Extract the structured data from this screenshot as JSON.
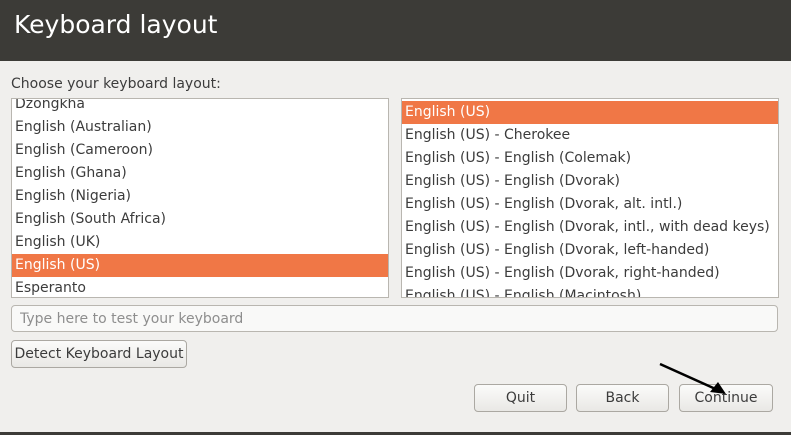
{
  "window": {
    "title": "Keyboard layout"
  },
  "prompt": "Choose your keyboard layout:",
  "layouts": {
    "items": [
      "Dzongkha",
      "English (Australian)",
      "English (Cameroon)",
      "English (Ghana)",
      "English (Nigeria)",
      "English (South Africa)",
      "English (UK)",
      "English (US)",
      "Esperanto"
    ],
    "selected": "English (US)"
  },
  "variants": {
    "items": [
      "English (US)",
      "English (US) - Cherokee",
      "English (US) - English (Colemak)",
      "English (US) - English (Dvorak)",
      "English (US) - English (Dvorak, alt. intl.)",
      "English (US) - English (Dvorak, intl., with dead keys)",
      "English (US) - English (Dvorak, left-handed)",
      "English (US) - English (Dvorak, right-handed)",
      "English (US) - English (Macintosh)"
    ],
    "selected": "English (US)"
  },
  "test_input": {
    "placeholder": "Type here to test your keyboard",
    "value": ""
  },
  "buttons": {
    "detect": "Detect Keyboard Layout",
    "quit": "Quit",
    "back": "Back",
    "continue": "Continue"
  },
  "colors": {
    "selection": "#f07746",
    "titlebar": "#3c3b37",
    "background": "#f0efed"
  }
}
